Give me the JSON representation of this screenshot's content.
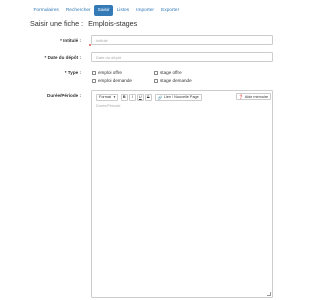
{
  "nav": {
    "tabs": [
      {
        "label": "Formulaires",
        "active": false
      },
      {
        "label": "Rechercher",
        "active": false
      },
      {
        "label": "Saisir",
        "active": true
      },
      {
        "label": "Listes",
        "active": false
      },
      {
        "label": "Importer",
        "active": false
      },
      {
        "label": "Exporter",
        "active": false
      }
    ]
  },
  "header": {
    "lead": "Saisir une fiche :",
    "title": "Emplois-stages"
  },
  "form": {
    "intitule": {
      "label": "* Intitulé :",
      "placeholder": "Intitulé"
    },
    "date_depot": {
      "label": "* Date du dépôt :",
      "placeholder": "Date du dépôt"
    },
    "type": {
      "label": "* Type :",
      "options": [
        "emploi offre",
        "stage offre",
        "emploi demande",
        "stage demande"
      ]
    },
    "duree": {
      "label": "Durée/Période :",
      "placeholder": "Durée/Période",
      "toolbar": {
        "format": "Format",
        "bold": "B",
        "italic": "I",
        "underline": "U",
        "strike": "S",
        "link": "Lien / Nouvelle Page",
        "help": "Aide mémoire"
      }
    }
  },
  "colors": {
    "primary": "#337ab7",
    "border": "#cccccc",
    "required": "#d9534f"
  }
}
